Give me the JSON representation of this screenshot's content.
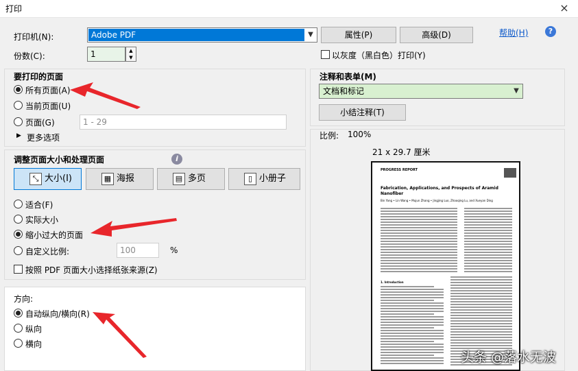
{
  "window": {
    "title": "打印",
    "close_glyph": "×"
  },
  "printer": {
    "label": "打印机(N):",
    "selected": "Adobe PDF",
    "properties_button": "属性(P)",
    "advanced_button": "高级(D)",
    "help_link": "帮助(H)",
    "help_icon": "question-circle-icon"
  },
  "copies": {
    "label": "份数(C):",
    "value": "1",
    "grayscale_label": "以灰度（黑白色）打印(Y)",
    "grayscale_checked": false
  },
  "pages_to_print": {
    "heading": "要打印的页面",
    "options": [
      {
        "label": "所有页面(A)",
        "checked": true
      },
      {
        "label": "当前页面(U)",
        "checked": false
      },
      {
        "label": "页面(G)",
        "checked": false
      }
    ],
    "range_value": "1 - 29",
    "more_options": "更多选项"
  },
  "page_sizing": {
    "heading": "调整页面大小和处理页面",
    "tabs": [
      {
        "label": "大小(I)",
        "active": true,
        "icon": "size-icon"
      },
      {
        "label": "海报",
        "active": false,
        "icon": "poster-icon"
      },
      {
        "label": "多页",
        "active": false,
        "icon": "multiple-pages-icon"
      },
      {
        "label": "小册子",
        "active": false,
        "icon": "booklet-icon"
      }
    ],
    "options": [
      {
        "label": "适合(F)",
        "checked": false
      },
      {
        "label": "实际大小",
        "checked": false
      },
      {
        "label": "缩小过大的页面",
        "checked": true
      },
      {
        "label": "自定义比例:",
        "checked": false
      }
    ],
    "custom_scale_value": "100",
    "percent": "%",
    "paper_source_label": "按照 PDF 页面大小选择纸张来源(Z)"
  },
  "orientation": {
    "heading": "方向:",
    "options": [
      {
        "label": "自动纵向/横向(R)",
        "checked": true
      },
      {
        "label": "纵向",
        "checked": false
      },
      {
        "label": "横向",
        "checked": false
      }
    ]
  },
  "comments_forms": {
    "heading": "注释和表单(M)",
    "selected": "文档和标记",
    "summarize_button": "小结注释(T)"
  },
  "preview": {
    "scale_label": "比例:",
    "scale_value": "100%",
    "paper_size": "21 x 29.7 厘米",
    "doc_header": "PROGRESS REPORT",
    "doc_title_1": "Fabrication, Applications, and Prospects of Aramid",
    "doc_title_2": "Nanofiber",
    "doc_authors": "Bin Yang • Lin Wang • Mujun Zhang • Jingjing Luo, Zhaoqing Lu, and Xueyan Ding",
    "doc_section": "1. Introduction"
  },
  "watermark": "头条 @落水无波",
  "colors": {
    "accent": "#0078d7",
    "annotation_arrow": "#e8262b",
    "green_select": "#d8f0d0"
  }
}
